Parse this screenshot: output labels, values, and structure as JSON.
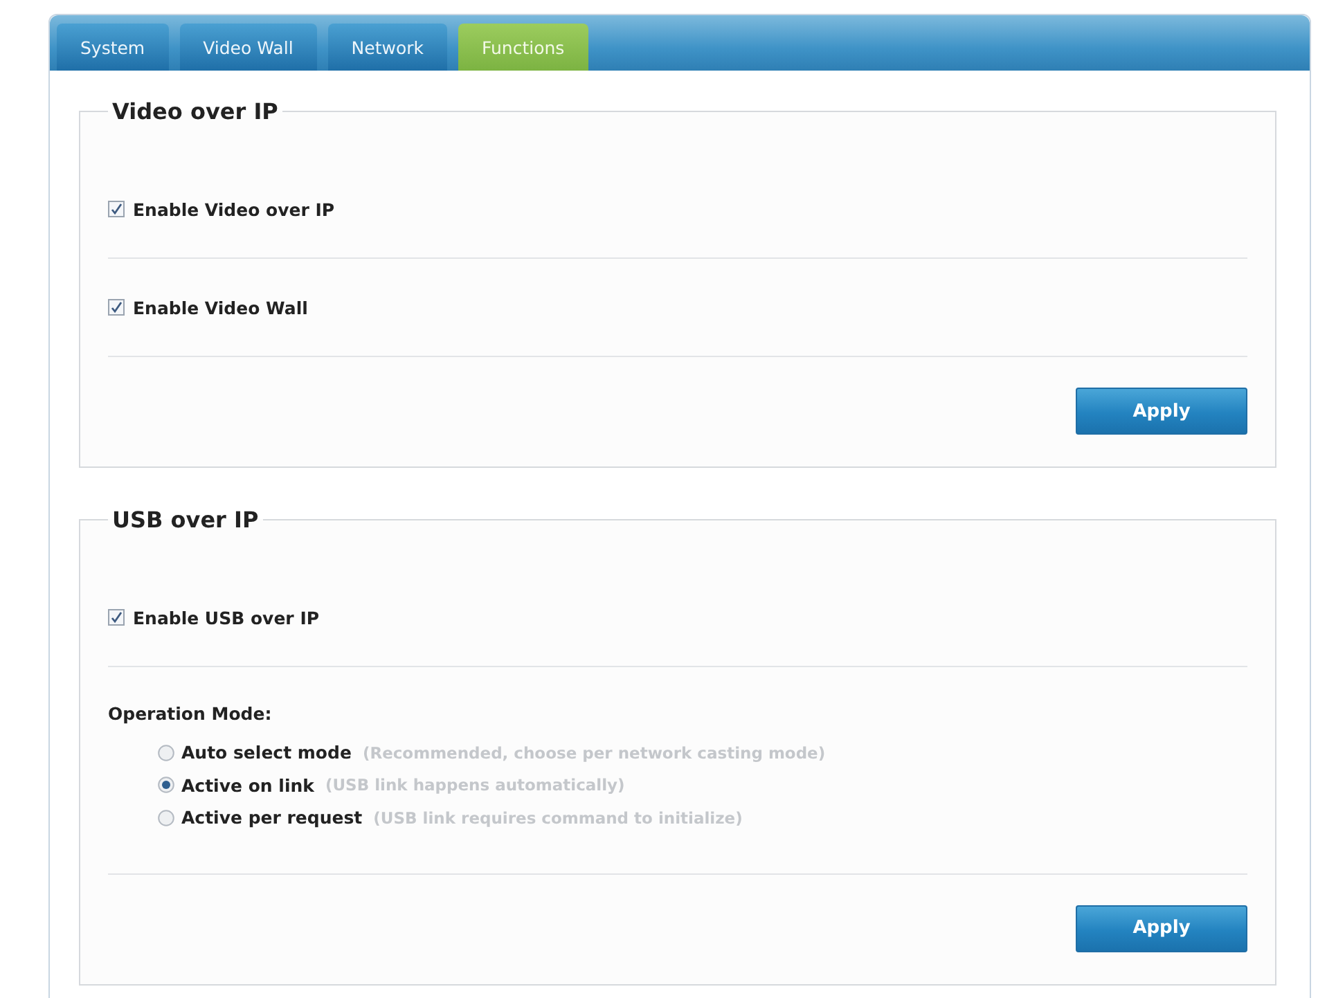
{
  "tabs": [
    {
      "label": "System",
      "selected": false
    },
    {
      "label": "Video Wall",
      "selected": false
    },
    {
      "label": "Network",
      "selected": false
    },
    {
      "label": "Functions",
      "selected": true
    }
  ],
  "sections": [
    {
      "title": "Video over IP",
      "items": [
        {
          "kind": "checkbox",
          "label": "Enable Video over IP",
          "checked": true
        },
        {
          "kind": "checkbox",
          "label": "Enable Video Wall",
          "checked": true
        }
      ],
      "button": "Apply"
    },
    {
      "title": "USB over IP",
      "items": [
        {
          "kind": "checkbox",
          "label": "Enable USB over IP",
          "checked": true
        },
        {
          "kind": "radio_group",
          "title": "Operation Mode:",
          "options": [
            {
              "label": "Auto select mode",
              "note": "(Recommended, choose per network casting mode)",
              "selected": false
            },
            {
              "label": "Active on link",
              "note": "(USB link happens automatically)",
              "selected": true
            },
            {
              "label": "Active per request",
              "note": "(USB link requires command to initialize)",
              "selected": false
            }
          ]
        }
      ],
      "button": "Apply"
    }
  ]
}
